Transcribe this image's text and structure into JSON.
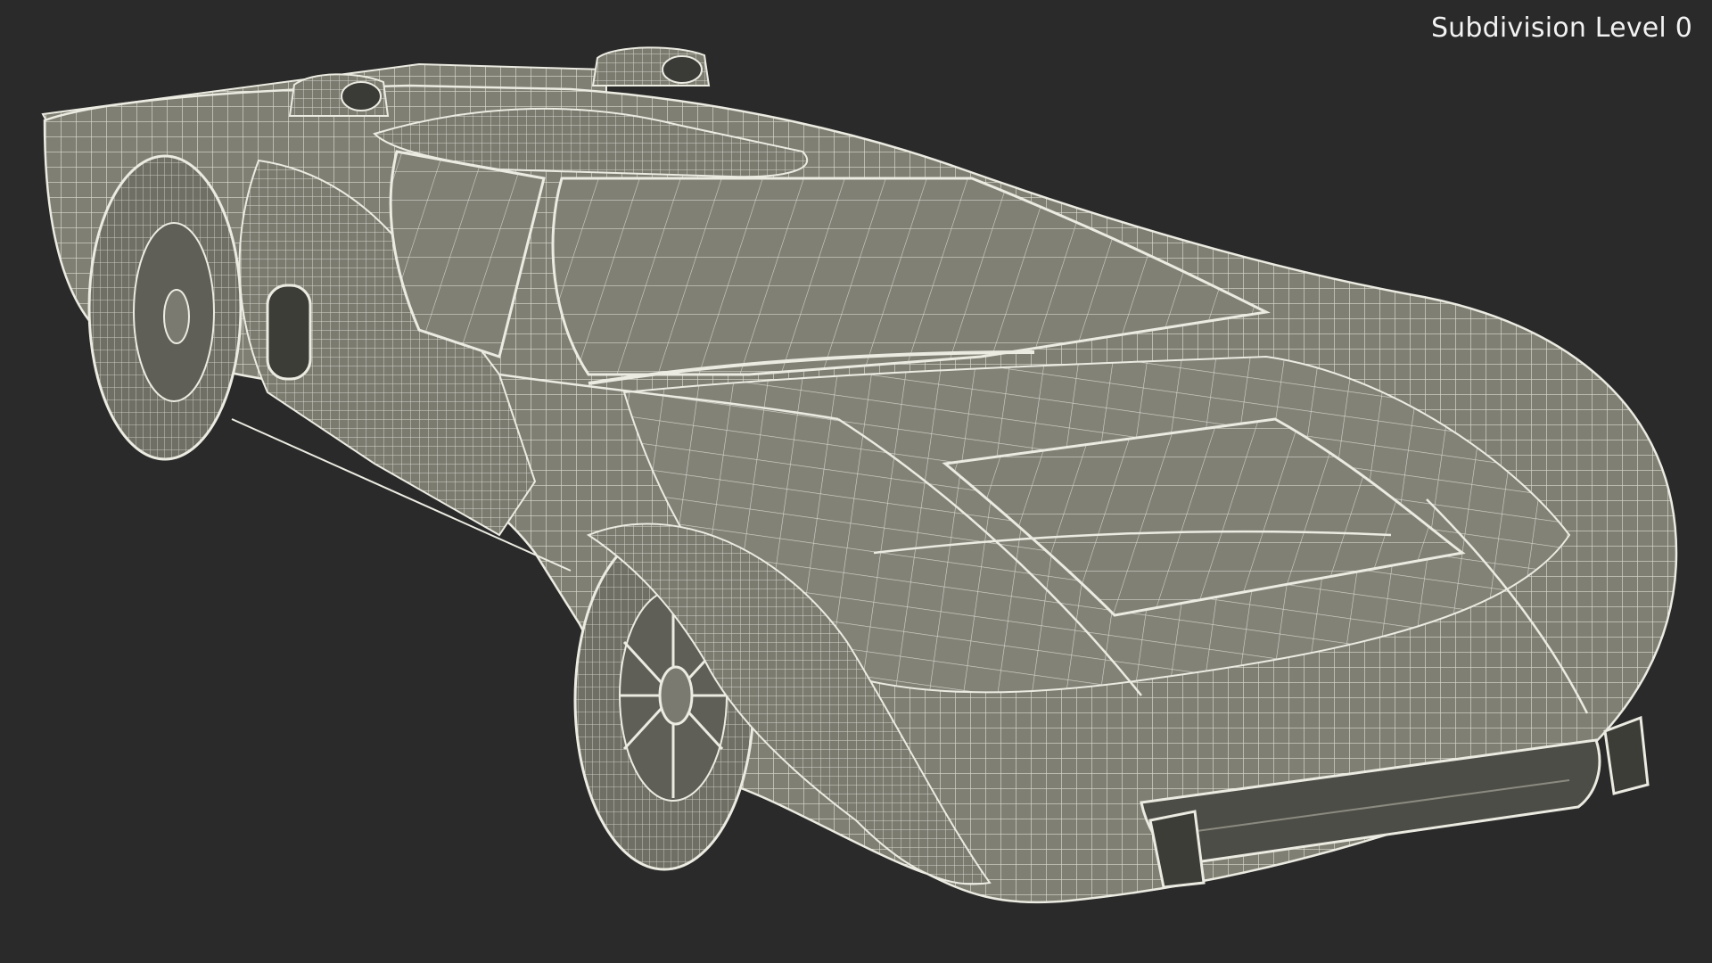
{
  "viewport": {
    "overlay_label": "Subdivision Level 0",
    "background_color": "#2a2a2a",
    "model_fill_color": "#7f7f74",
    "wire_color": "#ecebe2",
    "subject": "car-wireframe-render"
  }
}
